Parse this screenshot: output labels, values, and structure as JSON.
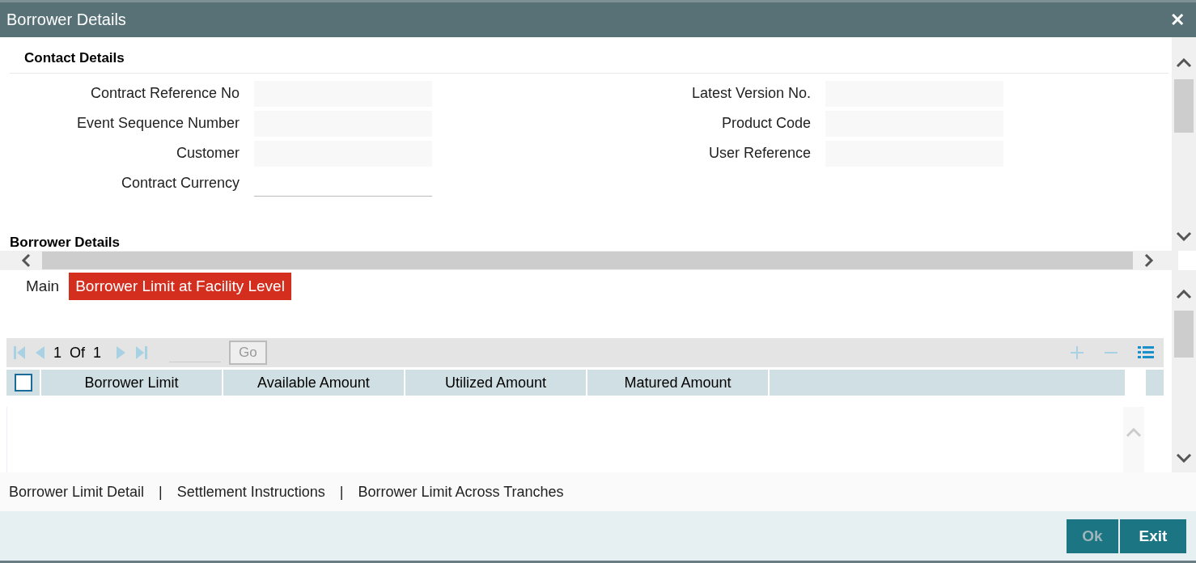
{
  "window": {
    "title": "Borrower Details",
    "close": "✕"
  },
  "contact_details": {
    "title": "Contact Details",
    "left_fields": [
      {
        "label": "Contract Reference No"
      },
      {
        "label": "Event Sequence Number"
      },
      {
        "label": "Customer"
      },
      {
        "label": "Contract Currency"
      }
    ],
    "right_fields": [
      {
        "label": "Latest Version No."
      },
      {
        "label": "Product Code"
      },
      {
        "label": "User Reference"
      }
    ]
  },
  "borrower_details": {
    "title": "Borrower Details",
    "tabs": [
      {
        "label": "Main",
        "selected": false
      },
      {
        "label": "Borrower Limit at Facility Level",
        "selected": true
      }
    ],
    "pager": {
      "current": "1",
      "of": "Of",
      "total": "1",
      "go": "Go"
    },
    "table": {
      "select_all_checked": false,
      "columns": [
        "Borrower Limit",
        "Available Amount",
        "Utilized Amount",
        "Matured Amount"
      ]
    }
  },
  "footer_links": [
    "Borrower Limit Detail",
    "Settlement Instructions",
    "Borrower Limit Across Tranches"
  ],
  "link_separator": "|",
  "buttons": [
    {
      "label": "Ok",
      "disabled": true
    },
    {
      "label": "Exit",
      "disabled": false
    }
  ]
}
